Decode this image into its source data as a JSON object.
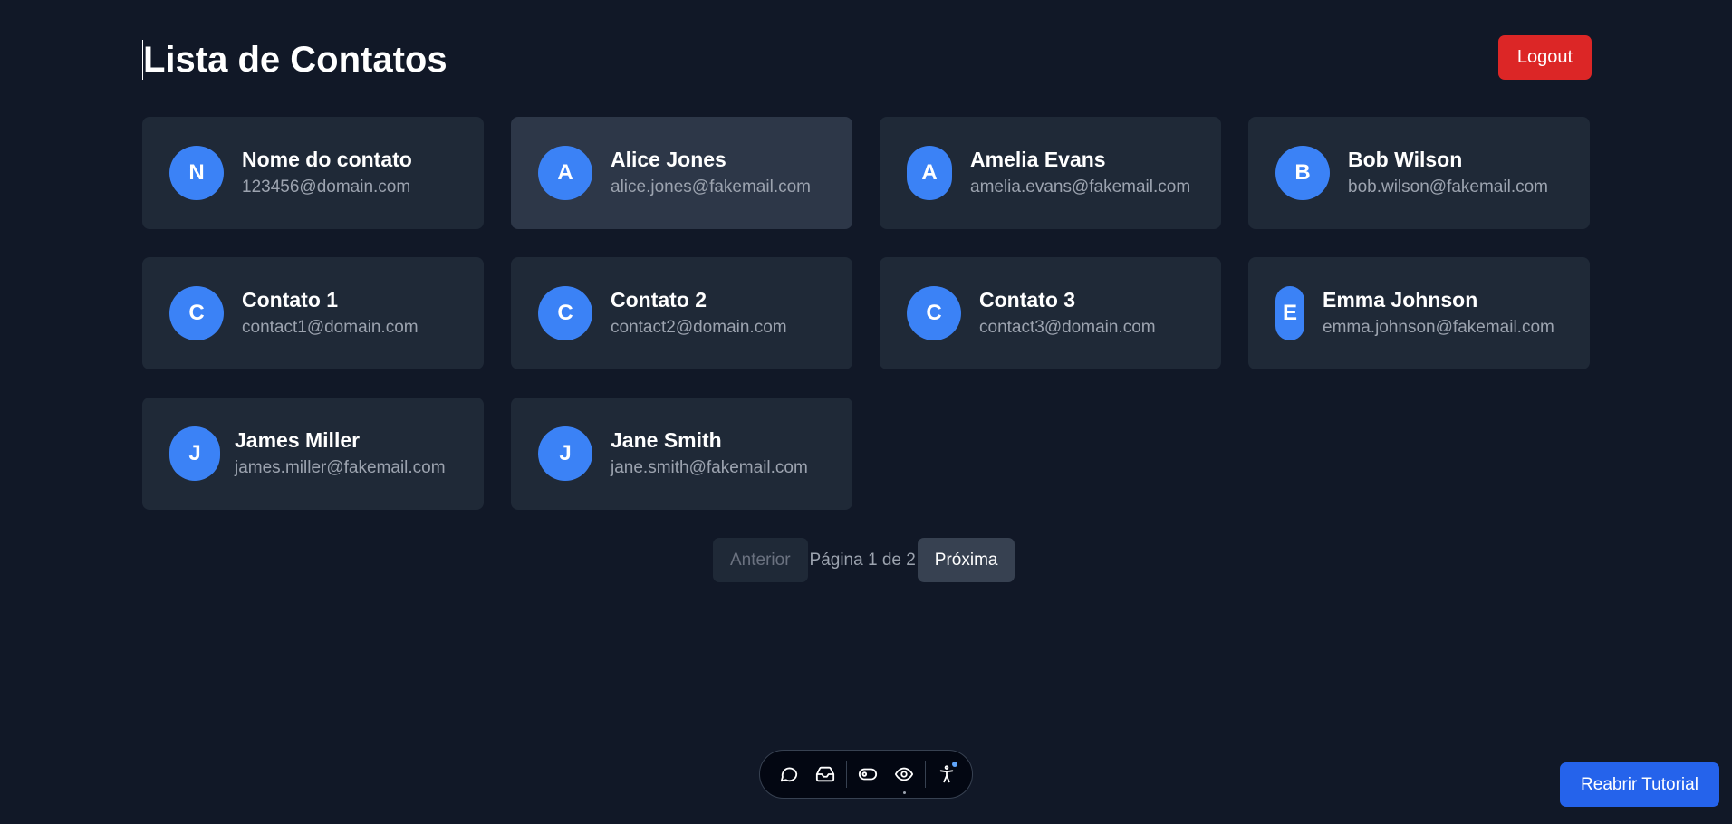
{
  "header": {
    "title": "Lista de Contatos",
    "logout_label": "Logout"
  },
  "contacts": [
    {
      "initial": "N",
      "name": "Nome do contato",
      "email": "123456@domain.com"
    },
    {
      "initial": "A",
      "name": "Alice Jones",
      "email": "alice.jones@fakemail.com"
    },
    {
      "initial": "A",
      "name": "Amelia Evans",
      "email": "amelia.evans@fakemail.com"
    },
    {
      "initial": "B",
      "name": "Bob Wilson",
      "email": "bob.wilson@fakemail.com"
    },
    {
      "initial": "C",
      "name": "Contato 1",
      "email": "contact1@domain.com"
    },
    {
      "initial": "C",
      "name": "Contato 2",
      "email": "contact2@domain.com"
    },
    {
      "initial": "C",
      "name": "Contato 3",
      "email": "contact3@domain.com"
    },
    {
      "initial": "E",
      "name": "Emma Johnson",
      "email": "emma.johnson@fakemail.com"
    },
    {
      "initial": "J",
      "name": "James Miller",
      "email": "james.miller@fakemail.com"
    },
    {
      "initial": "J",
      "name": "Jane Smith",
      "email": "jane.smith@fakemail.com"
    }
  ],
  "pagination": {
    "prev_label": "Anterior",
    "page_info": "Página 1 de 2",
    "next_label": "Próxima"
  },
  "toolbar": {
    "icons": [
      "chat-icon",
      "inbox-icon",
      "toggle-icon",
      "eye-icon",
      "accessibility-icon"
    ]
  },
  "tutorial": {
    "label": "Reabrir Tutorial"
  },
  "colors": {
    "background": "#111827",
    "card": "#1f2937",
    "avatar": "#3b82f6",
    "logout": "#dc2626",
    "tutorial": "#2563eb"
  }
}
